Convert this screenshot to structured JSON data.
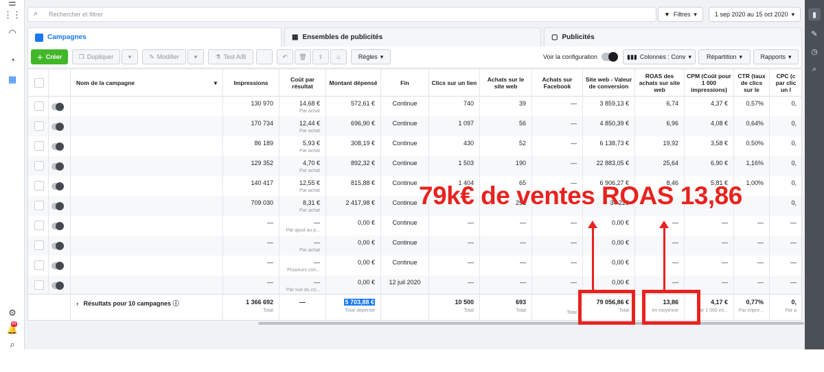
{
  "search": {
    "placeholder": "Rechercher et filtrer"
  },
  "filters": {
    "label": "Filtres",
    "date_range": "1 sep 2020 au 15 oct 2020"
  },
  "tabs": [
    {
      "label": "Campagnes"
    },
    {
      "label": "Ensembles de publicités"
    },
    {
      "label": "Publicités"
    }
  ],
  "toolbar": {
    "create": "Créer",
    "duplicate": "Dupliquer",
    "edit": "Modifier",
    "ab_test": "Test A/B",
    "rules": "Règles",
    "view_config": "Voir la configuration",
    "columns": "Colonnes : Conv",
    "breakdown": "Répartition",
    "reports": "Rapports"
  },
  "columns": [
    "Nom de la campagne",
    "Impressions",
    "Coût par résultat",
    "Montant dépensé",
    "Fin",
    "Clics sur un lien",
    "Achats sur le site web",
    "Achats sur Facebook",
    "Site web - Valeur de conversion",
    "ROAS des achats sur site web",
    "CPM (Coût pour 1 000 impressions)",
    "CTR (taux de clics sur le",
    "CPC (c par clic un l"
  ],
  "rows": [
    {
      "impressions": "130 970",
      "cost": "14,68 €",
      "cost_sub": "Par achat",
      "spent": "572,61 €",
      "end": "Continue",
      "clicks": "740",
      "purchases_web": "39",
      "purchases_fb": "—",
      "conv_value": "3 859,13 €",
      "roas": "6,74",
      "cpm": "4,37 €",
      "ctr": "0,57%",
      "cpc": "0,"
    },
    {
      "impressions": "170 734",
      "cost": "12,44 €",
      "cost_sub": "Par achat",
      "spent": "696,90 €",
      "end": "Continue",
      "clicks": "1 097",
      "purchases_web": "56",
      "purchases_fb": "—",
      "conv_value": "4 850,39 €",
      "roas": "6,96",
      "cpm": "4,08 €",
      "ctr": "0,64%",
      "cpc": "0,"
    },
    {
      "impressions": "86 189",
      "cost": "5,93 €",
      "cost_sub": "Par achat",
      "spent": "308,19 €",
      "end": "Continue",
      "clicks": "430",
      "purchases_web": "52",
      "purchases_fb": "—",
      "conv_value": "6 138,73 €",
      "roas": "19,92",
      "cpm": "3,58 €",
      "ctr": "0,50%",
      "cpc": "0,"
    },
    {
      "impressions": "129 352",
      "cost": "4,70 €",
      "cost_sub": "Par achat",
      "spent": "892,32 €",
      "end": "Continue",
      "clicks": "1 503",
      "purchases_web": "190",
      "purchases_fb": "—",
      "conv_value": "22 883,05 €",
      "roas": "25,64",
      "cpm": "6,90 €",
      "ctr": "1,16%",
      "cpc": "0,"
    },
    {
      "impressions": "140 417",
      "cost": "12,55 €",
      "cost_sub": "Par achat",
      "spent": "815,88 €",
      "end": "Continue",
      "clicks": "1 404",
      "purchases_web": "65",
      "purchases_fb": "—",
      "conv_value": "6 906,27 €",
      "roas": "8,46",
      "cpm": "5,81 €",
      "ctr": "1,00%",
      "cpc": "0,"
    },
    {
      "impressions": "709 030",
      "cost": "8,31 €",
      "cost_sub": "Par achat",
      "spent": "2 417,98 €",
      "end": "Continue",
      "clicks": "",
      "purchases_web": "291",
      "purchases_fb": "",
      "conv_value": "34 229",
      "roas": "",
      "cpm": "",
      "ctr": "",
      "cpc": "0,"
    },
    {
      "impressions": "—",
      "cost": "—",
      "cost_sub": "Par ajout au p...",
      "spent": "0,00 €",
      "end": "Continue",
      "clicks": "—",
      "purchases_web": "—",
      "purchases_fb": "—",
      "conv_value": "0,00 €",
      "roas": "—",
      "cpm": "—",
      "ctr": "—",
      "cpc": "—"
    },
    {
      "impressions": "—",
      "cost": "—",
      "cost_sub": "Par achat",
      "spent": "0,00 €",
      "end": "Continue",
      "clicks": "—",
      "purchases_web": "—",
      "purchases_fb": "—",
      "conv_value": "0,00 €",
      "roas": "—",
      "cpm": "—",
      "ctr": "—",
      "cpc": "—"
    },
    {
      "impressions": "—",
      "cost": "—",
      "cost_sub": "Plusieurs con...",
      "spent": "0,00 €",
      "end": "Continue",
      "clicks": "—",
      "purchases_web": "—",
      "purchases_fb": "—",
      "conv_value": "0,00 €",
      "roas": "—",
      "cpm": "—",
      "ctr": "—",
      "cpc": "—"
    },
    {
      "impressions": "—",
      "cost": "—",
      "cost_sub": "Par vue du co...",
      "spent": "0,00 €",
      "end": "12 juil 2020",
      "clicks": "—",
      "purchases_web": "—",
      "purchases_fb": "—",
      "conv_value": "0,00 €",
      "roas": "—",
      "cpm": "—",
      "ctr": "—",
      "cpc": "—"
    }
  ],
  "totals": {
    "label": "Résultats pour 10 campagnes",
    "impressions": "1 366 692",
    "impressions_sub": "Total",
    "cost": "—",
    "spent": "5 703,88 €",
    "spent_sub": "Total dépensé",
    "clicks": "10 500",
    "clicks_sub": "Total",
    "purchases_web": "693",
    "purchases_web_sub": "Total",
    "purchases_fb_sub": "Total",
    "conv_value": "79 056,86 €",
    "conv_value_sub": "Total",
    "roas": "13,86",
    "roas_sub": "en moyenne",
    "cpm": "4,17 €",
    "cpm_sub": "Par 1 000 im...",
    "ctr": "0,77%",
    "ctr_sub": "Par impre...",
    "cpc": "0,",
    "cpc_sub": "Par a"
  },
  "overlay": {
    "text": "79k€ de ventes ROAS 13,86",
    "color": "#e8231f"
  },
  "badge": {
    "notifications": "99"
  },
  "colors": {
    "accent": "#1877f2",
    "create": "#42b72a",
    "annotation": "#e8231f"
  }
}
